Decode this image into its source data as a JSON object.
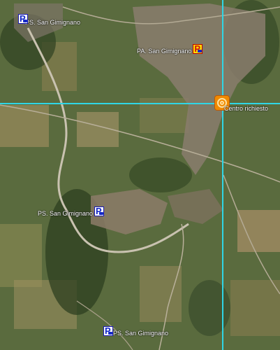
{
  "markers": [
    {
      "label": "PS. San Gimignano",
      "kind": "parking"
    },
    {
      "label": "PA. San Gimignano",
      "kind": "parking-primary"
    },
    {
      "label": "PS. San Gimignano",
      "kind": "parking"
    },
    {
      "label": "PS. San Gimignano",
      "kind": "parking"
    }
  ],
  "target": {
    "label": "Centro richiesto"
  },
  "colors": {
    "crosshair": "#2fd6e6",
    "parking": "#1428c8",
    "primary": "#d01010",
    "target": "#f08a00"
  }
}
